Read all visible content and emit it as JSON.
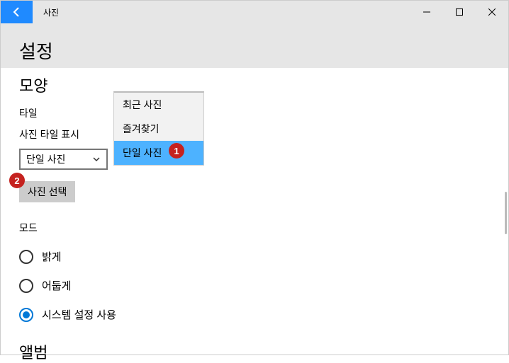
{
  "titlebar": {
    "app_name": "사진"
  },
  "page": {
    "title": "설정"
  },
  "appearance": {
    "heading": "모양",
    "tile_label": "타일",
    "tile_display_label": "사진 타일 표시",
    "dropdown_selected": "단일 사진",
    "choose_photo_button": "사진 선택"
  },
  "dropdown_options": {
    "recent": "최근 사진",
    "favorites": "즐겨찾기",
    "single": "단일 사진"
  },
  "mode": {
    "label": "모드",
    "light": "밝게",
    "dark": "어둡게",
    "system": "시스템 설정 사용"
  },
  "album": {
    "heading": "앨범"
  },
  "markers": {
    "one": "1",
    "two": "2"
  }
}
